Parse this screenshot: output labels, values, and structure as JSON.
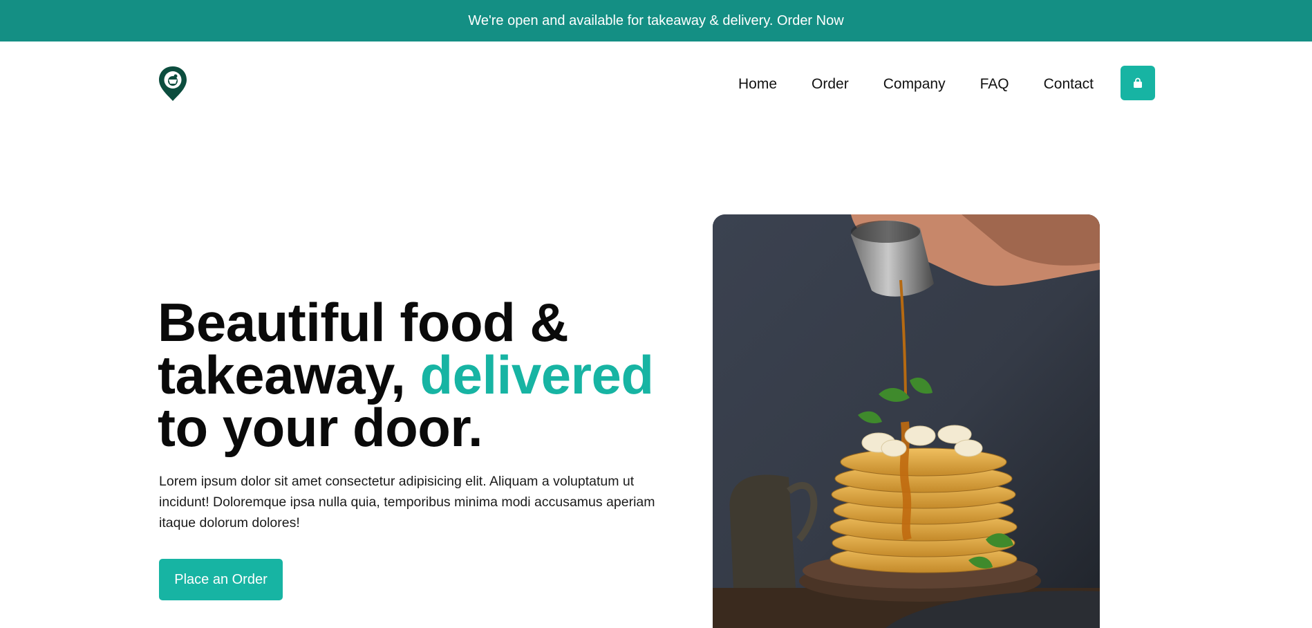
{
  "announcement": {
    "text": "We're open and available for takeaway & delivery. Order Now"
  },
  "nav": {
    "items": [
      "Home",
      "Order",
      "Company",
      "FAQ",
      "Contact"
    ]
  },
  "hero": {
    "title_line1": "Beautiful food &",
    "title_line2_pre": "takeaway, ",
    "title_line2_accent": "delivered",
    "title_line3": "to your door.",
    "description": "Lorem ipsum dolor sit amet consectetur adipisicing elit. Aliquam a voluptatum ut incidunt! Doloremque ipsa nulla quia, temporibus minima modi accusamus aperiam itaque dolorum dolores!",
    "cta_label": "Place an Order"
  },
  "colors": {
    "banner": "#148f84",
    "accent": "#17b4a3",
    "logo": "#0c4d3e"
  },
  "icons": {
    "logo": "location-pin-logo-icon",
    "cart": "shopping-bag-icon"
  }
}
